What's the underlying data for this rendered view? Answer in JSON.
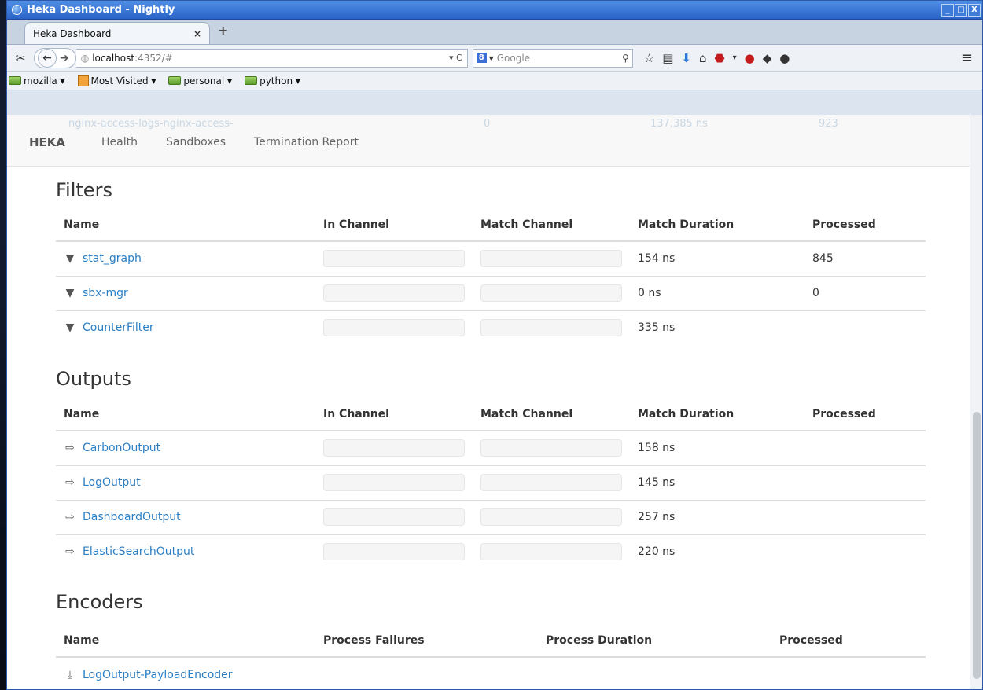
{
  "window": {
    "title": "Heka Dashboard - Nightly",
    "controls": [
      "_",
      "□",
      "X"
    ]
  },
  "tab": {
    "label": "Heka Dashboard",
    "close": "×",
    "new": "+"
  },
  "navbar": {
    "url_host": "localhost",
    "url_path": ":4352/#",
    "url_suffix": "▾ C",
    "search_engine": "8",
    "search_placeholder": "Google",
    "search_engine_arrow": "▾",
    "menu": "≡",
    "icons": [
      "scissors-icon",
      "back-icon",
      "forward-icon",
      "star-icon",
      "reading-list-icon",
      "download-icon",
      "home-icon",
      "adblock-icon",
      "addon-icon",
      "share-icon",
      "chat-icon",
      "menu-icon"
    ]
  },
  "bookmarks": [
    {
      "label": "mozilla ▾",
      "icon": "folder"
    },
    {
      "label": "Most Visited ▾",
      "icon": "most-visited"
    },
    {
      "label": "personal ▾",
      "icon": "folder"
    },
    {
      "label": "python ▾",
      "icon": "folder"
    }
  ],
  "page": {
    "brand": "HEKA",
    "nav": [
      "Health",
      "Sandboxes",
      "Termination Report"
    ],
    "ghost_row": [
      "nginx-access-logs-nginx-access-",
      "0",
      "137,385 ns",
      "923"
    ]
  },
  "filters": {
    "title": "Filters",
    "headers": [
      "Name",
      "In Channel",
      "Match Channel",
      "Match Duration",
      "Processed"
    ],
    "rows": [
      {
        "name": "stat_graph",
        "duration": "154 ns",
        "processed": "845"
      },
      {
        "name": "sbx-mgr",
        "duration": "0 ns",
        "processed": "0"
      },
      {
        "name": "CounterFilter",
        "duration": "335 ns",
        "processed": ""
      }
    ]
  },
  "outputs": {
    "title": "Outputs",
    "headers": [
      "Name",
      "In Channel",
      "Match Channel",
      "Match Duration",
      "Processed"
    ],
    "rows": [
      {
        "name": "CarbonOutput",
        "duration": "158 ns",
        "processed": ""
      },
      {
        "name": "LogOutput",
        "duration": "145 ns",
        "processed": ""
      },
      {
        "name": "DashboardOutput",
        "duration": "257 ns",
        "processed": ""
      },
      {
        "name": "ElasticSearchOutput",
        "duration": "220 ns",
        "processed": ""
      }
    ]
  },
  "encoders": {
    "title": "Encoders",
    "headers": [
      "Name",
      "Process Failures",
      "Process Duration",
      "Processed"
    ],
    "rows": [
      {
        "name": "LogOutput-PayloadEncoder"
      }
    ]
  }
}
